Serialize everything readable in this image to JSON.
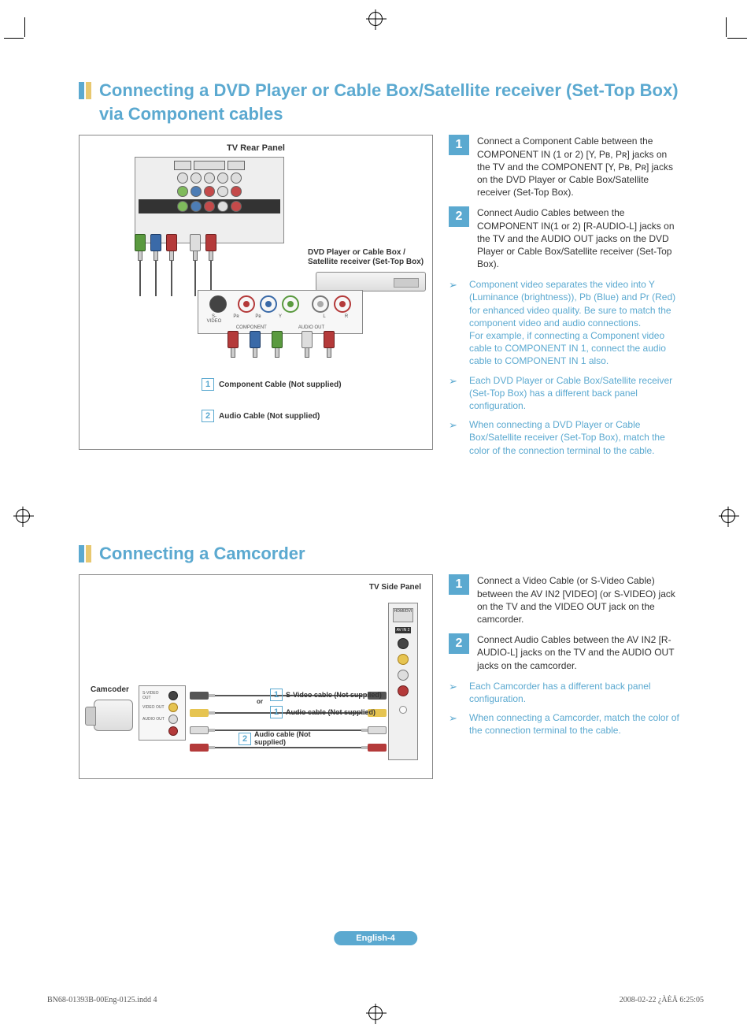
{
  "section1": {
    "title": "Connecting a DVD Player or Cable Box/Satellite receiver (Set-Top Box) via Component cables",
    "diagram": {
      "tv_panel_label": "TV Rear Panel",
      "device_label": "DVD Player or Cable Box / Satellite receiver (Set-Top Box)",
      "legend1_num": "1",
      "legend1_text": "Component Cable (Not supplied)",
      "legend2_num": "2",
      "legend2_text": "Audio Cable (Not supplied)"
    },
    "steps": [
      {
        "num": "1",
        "text": "Connect a Component Cable between the COMPONENT IN  (1 or 2) [Y, Pʙ, Pʀ] jacks on the TV and the COMPONENT [Y, Pʙ, Pʀ] jacks on the DVD Player or Cable Box/Satellite receiver (Set-Top Box)."
      },
      {
        "num": "2",
        "text": "Connect Audio Cables between the COMPONENT IN(1 or 2) [R-AUDIO-L] jacks on the TV and the AUDIO OUT jacks on the DVD Player or Cable Box/Satellite receiver (Set-Top Box)."
      }
    ],
    "notes": [
      "Component video separates the video into Y (Luminance (brightness)), Pb (Blue) and Pr (Red) for enhanced video quality. Be sure to match the component video and audio connections.\nFor example, if connecting a Component video cable to COMPONENT IN 1, connect the audio cable to COMPONENT IN 1 also.",
      "Each DVD Player or Cable Box/Satellite receiver (Set-Top Box) has a different back panel configuration.",
      "When connecting a DVD Player or Cable Box/Satellite receiver (Set-Top Box), match the color of the connection terminal to the cable."
    ]
  },
  "section2": {
    "title": "Connecting a Camcorder",
    "diagram": {
      "side_panel_label": "TV Side Panel",
      "camcorder_label": "Camcoder",
      "or_label": "or",
      "av_in_label": "AV IN 2",
      "cable1a_num": "1",
      "cable1a_text": "S-Video cable (Not supplied)",
      "cable1b_num": "1",
      "cable1b_text": "Audio cable (Not supplied)",
      "cable2_num": "2",
      "cable2_text": "Audio cable (Not supplied)"
    },
    "steps": [
      {
        "num": "1",
        "text": "Connect a Video Cable (or S-Video Cable) between the AV IN2 [VIDEO] (or S-VIDEO) jack on the TV and the VIDEO OUT jack on the camcorder."
      },
      {
        "num": "2",
        "text": "Connect Audio Cables between the AV IN2 [R-AUDIO-L] jacks on the TV and the AUDIO OUT jacks on the camcorder."
      }
    ],
    "notes": [
      "Each Camcorder has a different back panel configuration.",
      "When connecting a Camcorder, match the color of the connection terminal to the cable."
    ]
  },
  "footer": {
    "page_label": "English-4",
    "left": "BN68-01393B-00Eng-0125.indd   4",
    "right": "2008-02-22   ¿ÀÈÄ 6:25:05"
  }
}
